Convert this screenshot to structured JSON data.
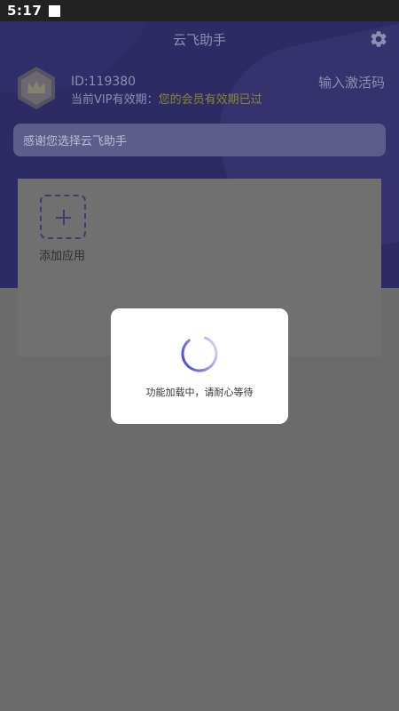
{
  "status_bar": {
    "time": "5:17"
  },
  "header": {
    "title": "云飞助手",
    "icons": {
      "settings": "gear-icon",
      "avatar": "crown-hexagon-icon"
    }
  },
  "user": {
    "id_text": "ID:119380",
    "vip_label": "当前VIP有效期：",
    "vip_status": "您的会员有效期已过",
    "activate_label": "输入激活码"
  },
  "notice": {
    "text": "感谢您选择云飞助手"
  },
  "apps": {
    "add_label": "添加应用"
  },
  "loading_dialog": {
    "message": "功能加载中，请耐心等待"
  },
  "colors": {
    "header_bg": "#2d2b63",
    "overlay": "#6b6b6b",
    "vip_warning": "#8e8532",
    "spinner": "#3b39c9"
  }
}
